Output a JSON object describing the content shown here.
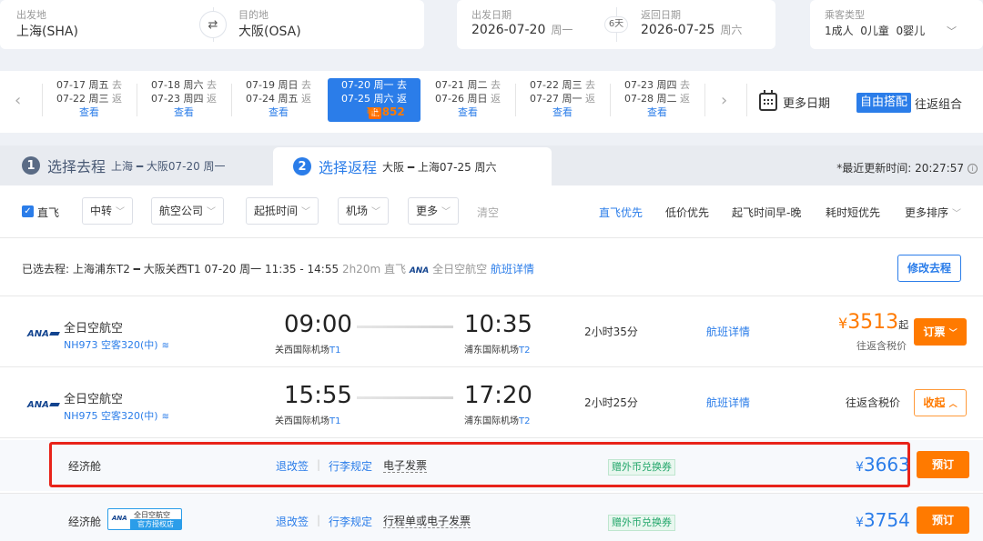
{
  "search": {
    "from_label": "出发地",
    "from_value": "上海(SHA)",
    "to_label": "目的地",
    "to_value": "大阪(OSA)",
    "depart_label": "出发日期",
    "depart_date": "2026-07-20",
    "depart_week": "周一",
    "nights": "6天",
    "return_label": "返回日期",
    "return_date": "2026-07-25",
    "return_week": "周六",
    "pax_label": "乘客类型",
    "pax_value": "1成人  0儿童  0婴儿"
  },
  "dates": [
    {
      "l1": "07-17 周五",
      "t1": "去",
      "l2": "07-22 周三",
      "t2": "返",
      "action": "查看"
    },
    {
      "l1": "07-18 周六",
      "t1": "去",
      "l2": "07-23 周四",
      "t2": "返",
      "action": "查看"
    },
    {
      "l1": "07-19 周日",
      "t1": "去",
      "l2": "07-24 周五",
      "t2": "返",
      "action": "查看"
    },
    {
      "l1": "07-20 周一",
      "t1": "去",
      "l2": "07-25 周六",
      "t2": "返",
      "price": "¥2852",
      "tag": "低"
    },
    {
      "l1": "07-21 周二",
      "t1": "去",
      "l2": "07-26 周日",
      "t2": "返",
      "action": "查看"
    },
    {
      "l1": "07-22 周三",
      "t1": "去",
      "l2": "07-27 周一",
      "t2": "返",
      "action": "查看"
    },
    {
      "l1": "07-23 周四",
      "t1": "去",
      "l2": "07-28 周二",
      "t2": "返",
      "action": "查看"
    }
  ],
  "more_dates": "更多日期",
  "free_combo": "自由搭配",
  "roundtrip_combo": "往返组合",
  "steps": {
    "s1_num": "1",
    "s1_title": "选择去程",
    "s1_sub": "上海 ━ 大阪07-20 周一",
    "s2_num": "2",
    "s2_title": "选择返程",
    "s2_sub": "大阪 ━ 上海07-25 周六",
    "updated": "*最近更新时间: 20:27:57"
  },
  "filters": {
    "direct": "直飞",
    "transfer": "中转",
    "airline": "航空公司",
    "times": "起抵时间",
    "airport": "机场",
    "more": "更多",
    "clear": "清空",
    "sort_direct": "直飞优先",
    "sort_low": "低价优先",
    "sort_early": "起飞时间早-晚",
    "sort_short": "耗时短优先",
    "sort_more": "更多排序"
  },
  "selected": {
    "prefix": "已选去程:",
    "route": "上海浦东T2 ━ 大阪关西T1 07-20 周一 11:35 - 14:55",
    "duration": "2h20m",
    "direct": "直飞",
    "airline": "全日空航空",
    "details": "航班详情",
    "change_btn": "修改去程"
  },
  "flights": [
    {
      "logo": "ANA",
      "airline": "全日空航空",
      "flight_no": "NH973 空客320(中)",
      "dep_time": "09:00",
      "dep_airport": "关西国际机场",
      "dep_term": "T1",
      "arr_time": "10:35",
      "arr_airport": "浦东国际机场",
      "arr_term": "T2",
      "duration": "2小时35分",
      "details": "航班详情",
      "price_symbol": "¥",
      "price": "3513",
      "price_suffix": "起",
      "tax_note": "往返含税价",
      "button": "订票"
    },
    {
      "logo": "ANA",
      "airline": "全日空航空",
      "flight_no": "NH975 空客320(中)",
      "dep_time": "15:55",
      "dep_airport": "关西国际机场",
      "dep_term": "T1",
      "arr_time": "17:20",
      "arr_airport": "浦东国际机场",
      "arr_term": "T2",
      "duration": "2小时25分",
      "details": "航班详情",
      "tax_note": "往返含税价",
      "button": "收起"
    }
  ],
  "fares": [
    {
      "cabin": "经济舱",
      "refund": "退改签",
      "baggage": "行李规定",
      "invoice": "电子发票",
      "voucher": "赠外币兑换券",
      "price_symbol": "¥",
      "price": "3663",
      "button": "预订"
    },
    {
      "cabin": "经济舱",
      "badge_logo": "ANA",
      "badge_top": "全日空航空",
      "badge_bottom": "官方授权店",
      "refund": "退改签",
      "baggage": "行李规定",
      "invoice": "行程单或电子发票",
      "voucher": "赠外币兑换券",
      "price_symbol": "¥",
      "price": "3754",
      "button": "预订"
    }
  ],
  "colors": {
    "brand_blue": "#2b7de9",
    "accent_orange": "#ff7a00",
    "highlight_red": "#e8231a"
  }
}
